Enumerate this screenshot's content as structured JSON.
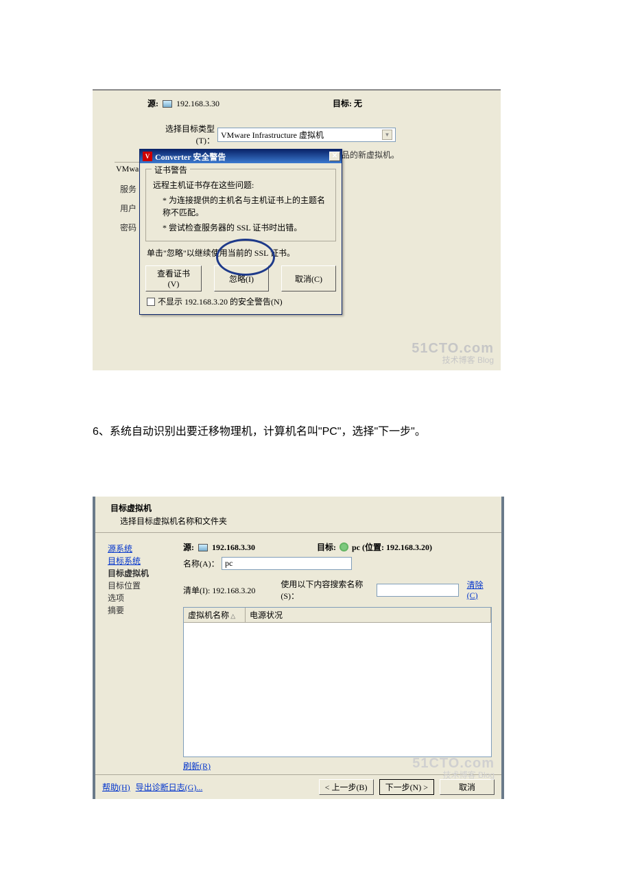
{
  "s1": {
    "source_label": "源:",
    "source_ip": "192.168.3.30",
    "target_label": "目标: 无",
    "type_label": "选择目标类型(T)：",
    "type_value": "VMware Infrastructure 虚拟机",
    "type_hint": "创建用于 VMware Infrastructure 产品的新虚拟机。",
    "fs_label": "VMwa",
    "side1": "服务",
    "side2": "用户",
    "side3": "密码",
    "dlg_title": "Converter 安全警告",
    "grp_title": "证书警告",
    "l1": "远程主机证书存在这些问题:",
    "l2": "* 为连接提供的主机名与主机证书上的主题名称不匹配。",
    "l3": "* 尝试检查服务器的 SSL 证书时出错。",
    "l4": "单击\"忽略\"以继续使用当前的 SSL 证书。",
    "btn_view": "查看证书(V)",
    "btn_ignore": "忽略(I)",
    "btn_cancel": "取消(C)",
    "chk": "不显示 192.168.3.20 的安全警告(N)"
  },
  "step6": "6、系统自动识别出要迁移物理机，计算机名叫\"PC\"，选择\"下一步\"。",
  "s2": {
    "title": "目标虚拟机",
    "subtitle": "选择目标虚拟机名称和文件夹",
    "nav1": "源系统",
    "nav2": "目标系统",
    "nav3": "目标虚拟机",
    "nav4": "目标位置",
    "nav5": "选项",
    "nav6": "摘要",
    "src_label": "源:",
    "src_ip": "192.168.3.30",
    "tgt_label": "目标:",
    "tgt_val": "pc (位置: 192.168.3.20)",
    "name_label": "名称(A)：",
    "name_value": "pc",
    "list_label": "清单(I): 192.168.3.20",
    "search_label": "使用以下内容搜索名称(S)：",
    "clear": "清除(C)",
    "col1": "虚拟机名称",
    "col2": "电源状况",
    "refresh": "刷新(R)",
    "help": "帮助(H)",
    "export": "导出诊断日志(G)...",
    "back": "< 上一步(B)",
    "next": "下一步(N) >",
    "cancel": "取消"
  },
  "wm": {
    "big": "51CTO.com",
    "small1": "技术博客",
    "small2": "Blog"
  }
}
